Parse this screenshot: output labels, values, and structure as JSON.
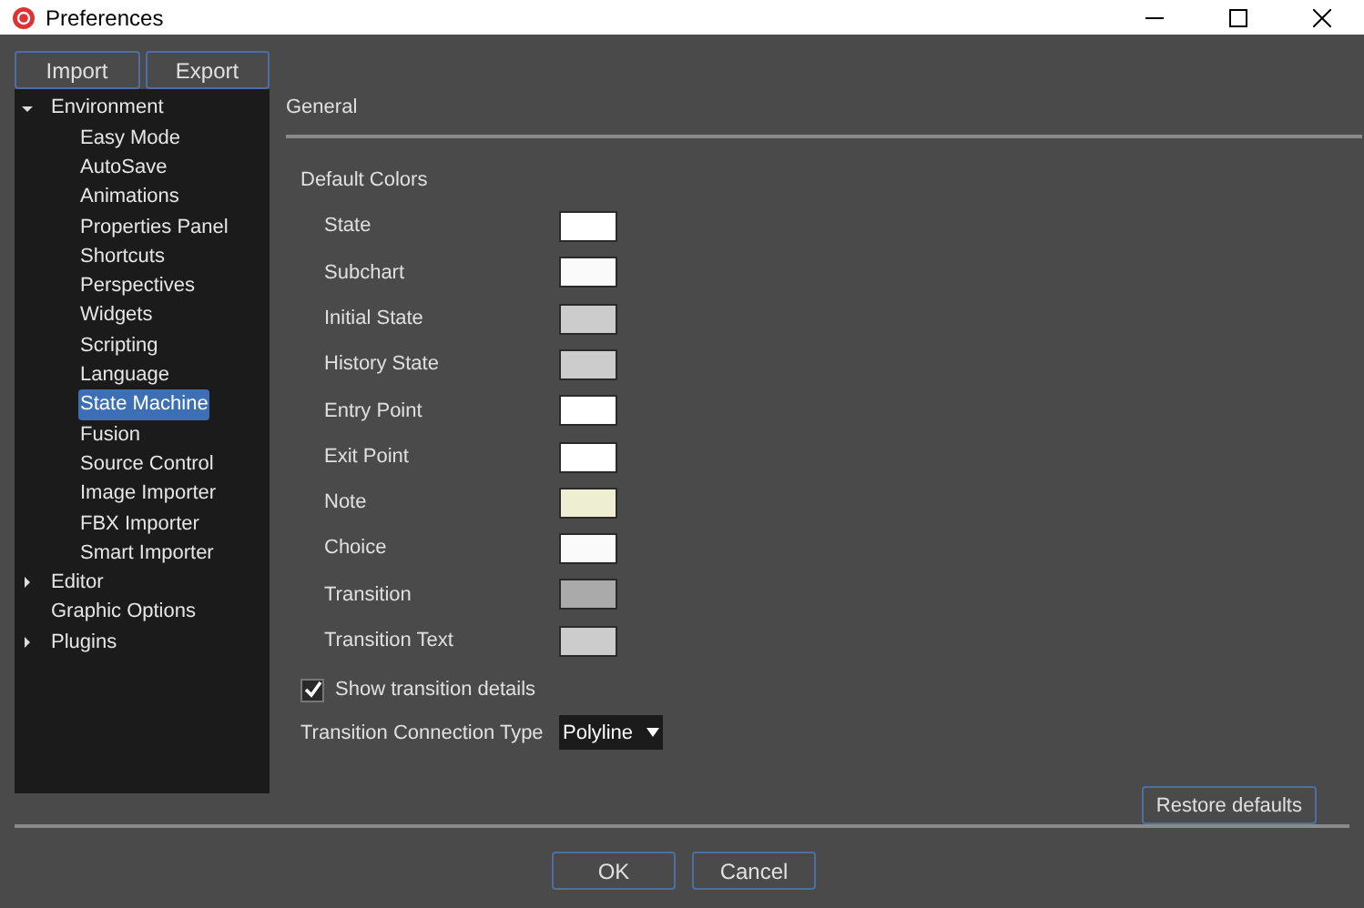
{
  "window": {
    "title": "Preferences"
  },
  "import_export": [
    "Import",
    "Export"
  ],
  "tree": [
    {
      "label": "Environment",
      "expanded": true,
      "selected": false,
      "children": [
        {
          "label": "Easy Mode",
          "selected": false
        },
        {
          "label": "AutoSave",
          "selected": false
        },
        {
          "label": "Animations",
          "selected": false
        },
        {
          "label": "Properties Panel",
          "selected": false
        },
        {
          "label": "Shortcuts",
          "selected": false
        },
        {
          "label": "Perspectives",
          "selected": false
        },
        {
          "label": "Widgets",
          "selected": false
        },
        {
          "label": "Scripting",
          "selected": false
        },
        {
          "label": "Language",
          "selected": false
        },
        {
          "label": "State Machine",
          "selected": true
        },
        {
          "label": "Fusion",
          "selected": false
        },
        {
          "label": "Source Control",
          "selected": false
        },
        {
          "label": "Image Importer",
          "selected": false
        },
        {
          "label": "FBX Importer",
          "selected": false
        },
        {
          "label": "Smart Importer",
          "selected": false
        }
      ]
    },
    {
      "label": "Editor",
      "expanded": false,
      "selected": false
    },
    {
      "label": "Graphic Options",
      "selected": false
    },
    {
      "label": "Plugins",
      "expanded": false,
      "selected": false
    }
  ],
  "section_title": "General",
  "group_title": "Default Colors",
  "colors": [
    {
      "label": "State",
      "color": "#ffffff"
    },
    {
      "label": "Subchart",
      "color": "#fafafa"
    },
    {
      "label": "Initial State",
      "color": "#cccccc"
    },
    {
      "label": "History State",
      "color": "#cccccc"
    },
    {
      "label": "Entry Point",
      "color": "#ffffff"
    },
    {
      "label": "Exit Point",
      "color": "#ffffff"
    },
    {
      "label": "Note",
      "color": "#eeeed2"
    },
    {
      "label": "Choice",
      "color": "#fafafa"
    },
    {
      "label": "Transition",
      "color": "#aaaaaa"
    },
    {
      "label": "Transition Text",
      "color": "#cccccc"
    }
  ],
  "show_transition_details": {
    "label": "Show transition details",
    "checked": true
  },
  "connection_type": {
    "label": "Transition Connection Type",
    "value": "Polyline"
  },
  "restore_button": "Restore defaults",
  "buttons": [
    "OK",
    "Cancel"
  ]
}
